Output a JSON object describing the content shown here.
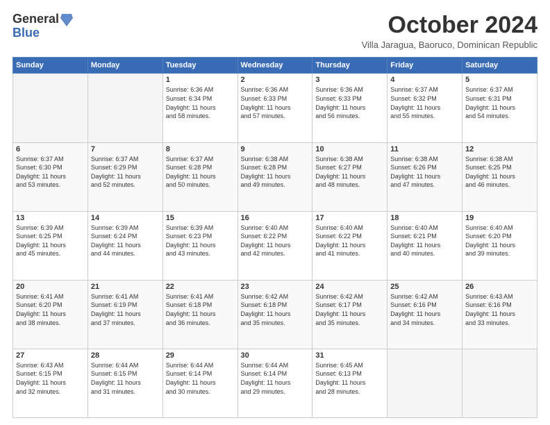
{
  "logo": {
    "general": "General",
    "blue": "Blue"
  },
  "title": "October 2024",
  "subtitle": "Villa Jaragua, Baoruco, Dominican Republic",
  "days_of_week": [
    "Sunday",
    "Monday",
    "Tuesday",
    "Wednesday",
    "Thursday",
    "Friday",
    "Saturday"
  ],
  "weeks": [
    [
      {
        "day": "",
        "info": ""
      },
      {
        "day": "",
        "info": ""
      },
      {
        "day": "1",
        "info": "Sunrise: 6:36 AM\nSunset: 6:34 PM\nDaylight: 11 hours\nand 58 minutes."
      },
      {
        "day": "2",
        "info": "Sunrise: 6:36 AM\nSunset: 6:33 PM\nDaylight: 11 hours\nand 57 minutes."
      },
      {
        "day": "3",
        "info": "Sunrise: 6:36 AM\nSunset: 6:33 PM\nDaylight: 11 hours\nand 56 minutes."
      },
      {
        "day": "4",
        "info": "Sunrise: 6:37 AM\nSunset: 6:32 PM\nDaylight: 11 hours\nand 55 minutes."
      },
      {
        "day": "5",
        "info": "Sunrise: 6:37 AM\nSunset: 6:31 PM\nDaylight: 11 hours\nand 54 minutes."
      }
    ],
    [
      {
        "day": "6",
        "info": "Sunrise: 6:37 AM\nSunset: 6:30 PM\nDaylight: 11 hours\nand 53 minutes."
      },
      {
        "day": "7",
        "info": "Sunrise: 6:37 AM\nSunset: 6:29 PM\nDaylight: 11 hours\nand 52 minutes."
      },
      {
        "day": "8",
        "info": "Sunrise: 6:37 AM\nSunset: 6:28 PM\nDaylight: 11 hours\nand 50 minutes."
      },
      {
        "day": "9",
        "info": "Sunrise: 6:38 AM\nSunset: 6:28 PM\nDaylight: 11 hours\nand 49 minutes."
      },
      {
        "day": "10",
        "info": "Sunrise: 6:38 AM\nSunset: 6:27 PM\nDaylight: 11 hours\nand 48 minutes."
      },
      {
        "day": "11",
        "info": "Sunrise: 6:38 AM\nSunset: 6:26 PM\nDaylight: 11 hours\nand 47 minutes."
      },
      {
        "day": "12",
        "info": "Sunrise: 6:38 AM\nSunset: 6:25 PM\nDaylight: 11 hours\nand 46 minutes."
      }
    ],
    [
      {
        "day": "13",
        "info": "Sunrise: 6:39 AM\nSunset: 6:25 PM\nDaylight: 11 hours\nand 45 minutes."
      },
      {
        "day": "14",
        "info": "Sunrise: 6:39 AM\nSunset: 6:24 PM\nDaylight: 11 hours\nand 44 minutes."
      },
      {
        "day": "15",
        "info": "Sunrise: 6:39 AM\nSunset: 6:23 PM\nDaylight: 11 hours\nand 43 minutes."
      },
      {
        "day": "16",
        "info": "Sunrise: 6:40 AM\nSunset: 6:22 PM\nDaylight: 11 hours\nand 42 minutes."
      },
      {
        "day": "17",
        "info": "Sunrise: 6:40 AM\nSunset: 6:22 PM\nDaylight: 11 hours\nand 41 minutes."
      },
      {
        "day": "18",
        "info": "Sunrise: 6:40 AM\nSunset: 6:21 PM\nDaylight: 11 hours\nand 40 minutes."
      },
      {
        "day": "19",
        "info": "Sunrise: 6:40 AM\nSunset: 6:20 PM\nDaylight: 11 hours\nand 39 minutes."
      }
    ],
    [
      {
        "day": "20",
        "info": "Sunrise: 6:41 AM\nSunset: 6:20 PM\nDaylight: 11 hours\nand 38 minutes."
      },
      {
        "day": "21",
        "info": "Sunrise: 6:41 AM\nSunset: 6:19 PM\nDaylight: 11 hours\nand 37 minutes."
      },
      {
        "day": "22",
        "info": "Sunrise: 6:41 AM\nSunset: 6:18 PM\nDaylight: 11 hours\nand 36 minutes."
      },
      {
        "day": "23",
        "info": "Sunrise: 6:42 AM\nSunset: 6:18 PM\nDaylight: 11 hours\nand 35 minutes."
      },
      {
        "day": "24",
        "info": "Sunrise: 6:42 AM\nSunset: 6:17 PM\nDaylight: 11 hours\nand 35 minutes."
      },
      {
        "day": "25",
        "info": "Sunrise: 6:42 AM\nSunset: 6:16 PM\nDaylight: 11 hours\nand 34 minutes."
      },
      {
        "day": "26",
        "info": "Sunrise: 6:43 AM\nSunset: 6:16 PM\nDaylight: 11 hours\nand 33 minutes."
      }
    ],
    [
      {
        "day": "27",
        "info": "Sunrise: 6:43 AM\nSunset: 6:15 PM\nDaylight: 11 hours\nand 32 minutes."
      },
      {
        "day": "28",
        "info": "Sunrise: 6:44 AM\nSunset: 6:15 PM\nDaylight: 11 hours\nand 31 minutes."
      },
      {
        "day": "29",
        "info": "Sunrise: 6:44 AM\nSunset: 6:14 PM\nDaylight: 11 hours\nand 30 minutes."
      },
      {
        "day": "30",
        "info": "Sunrise: 6:44 AM\nSunset: 6:14 PM\nDaylight: 11 hours\nand 29 minutes."
      },
      {
        "day": "31",
        "info": "Sunrise: 6:45 AM\nSunset: 6:13 PM\nDaylight: 11 hours\nand 28 minutes."
      },
      {
        "day": "",
        "info": ""
      },
      {
        "day": "",
        "info": ""
      }
    ]
  ]
}
